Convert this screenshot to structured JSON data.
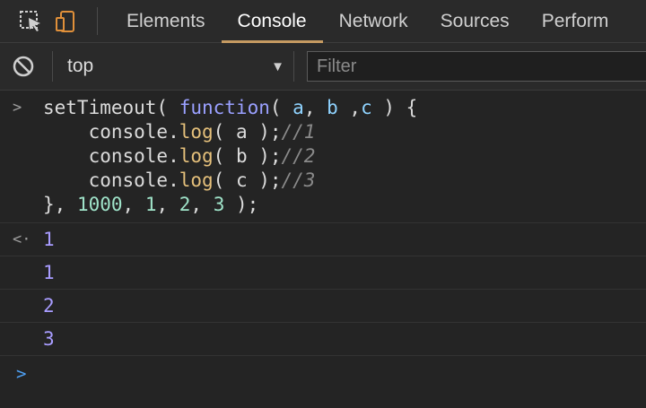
{
  "tabs": {
    "items": [
      "Elements",
      "Console",
      "Network",
      "Sources",
      "Perform"
    ],
    "active": "Console"
  },
  "toolbar": {
    "context": "top",
    "filter_placeholder": "Filter"
  },
  "console": {
    "input_lines": [
      "setTimeout( function( a, b ,c ) {",
      "    console.log( a );//1",
      "    console.log( b );//2",
      "    console.log( c );//3",
      "}, 1000, 1, 2, 3 );"
    ],
    "return_value": "1",
    "outputs": [
      "1",
      "2",
      "3"
    ]
  },
  "colors": {
    "accent": "#c59a61",
    "keyword": "#9aa0ff",
    "param": "#8fd3ff",
    "function": "#e5c07b",
    "number": "#9fe3c9",
    "output_number": "#a89cff",
    "prompt": "#4ea1f5"
  },
  "icons": [
    "inspect-element-icon",
    "device-toolbar-icon",
    "clear-console-icon",
    "dropdown-arrow-icon",
    "input-chevron-icon",
    "return-chevron-icon",
    "prompt-chevron-icon"
  ]
}
